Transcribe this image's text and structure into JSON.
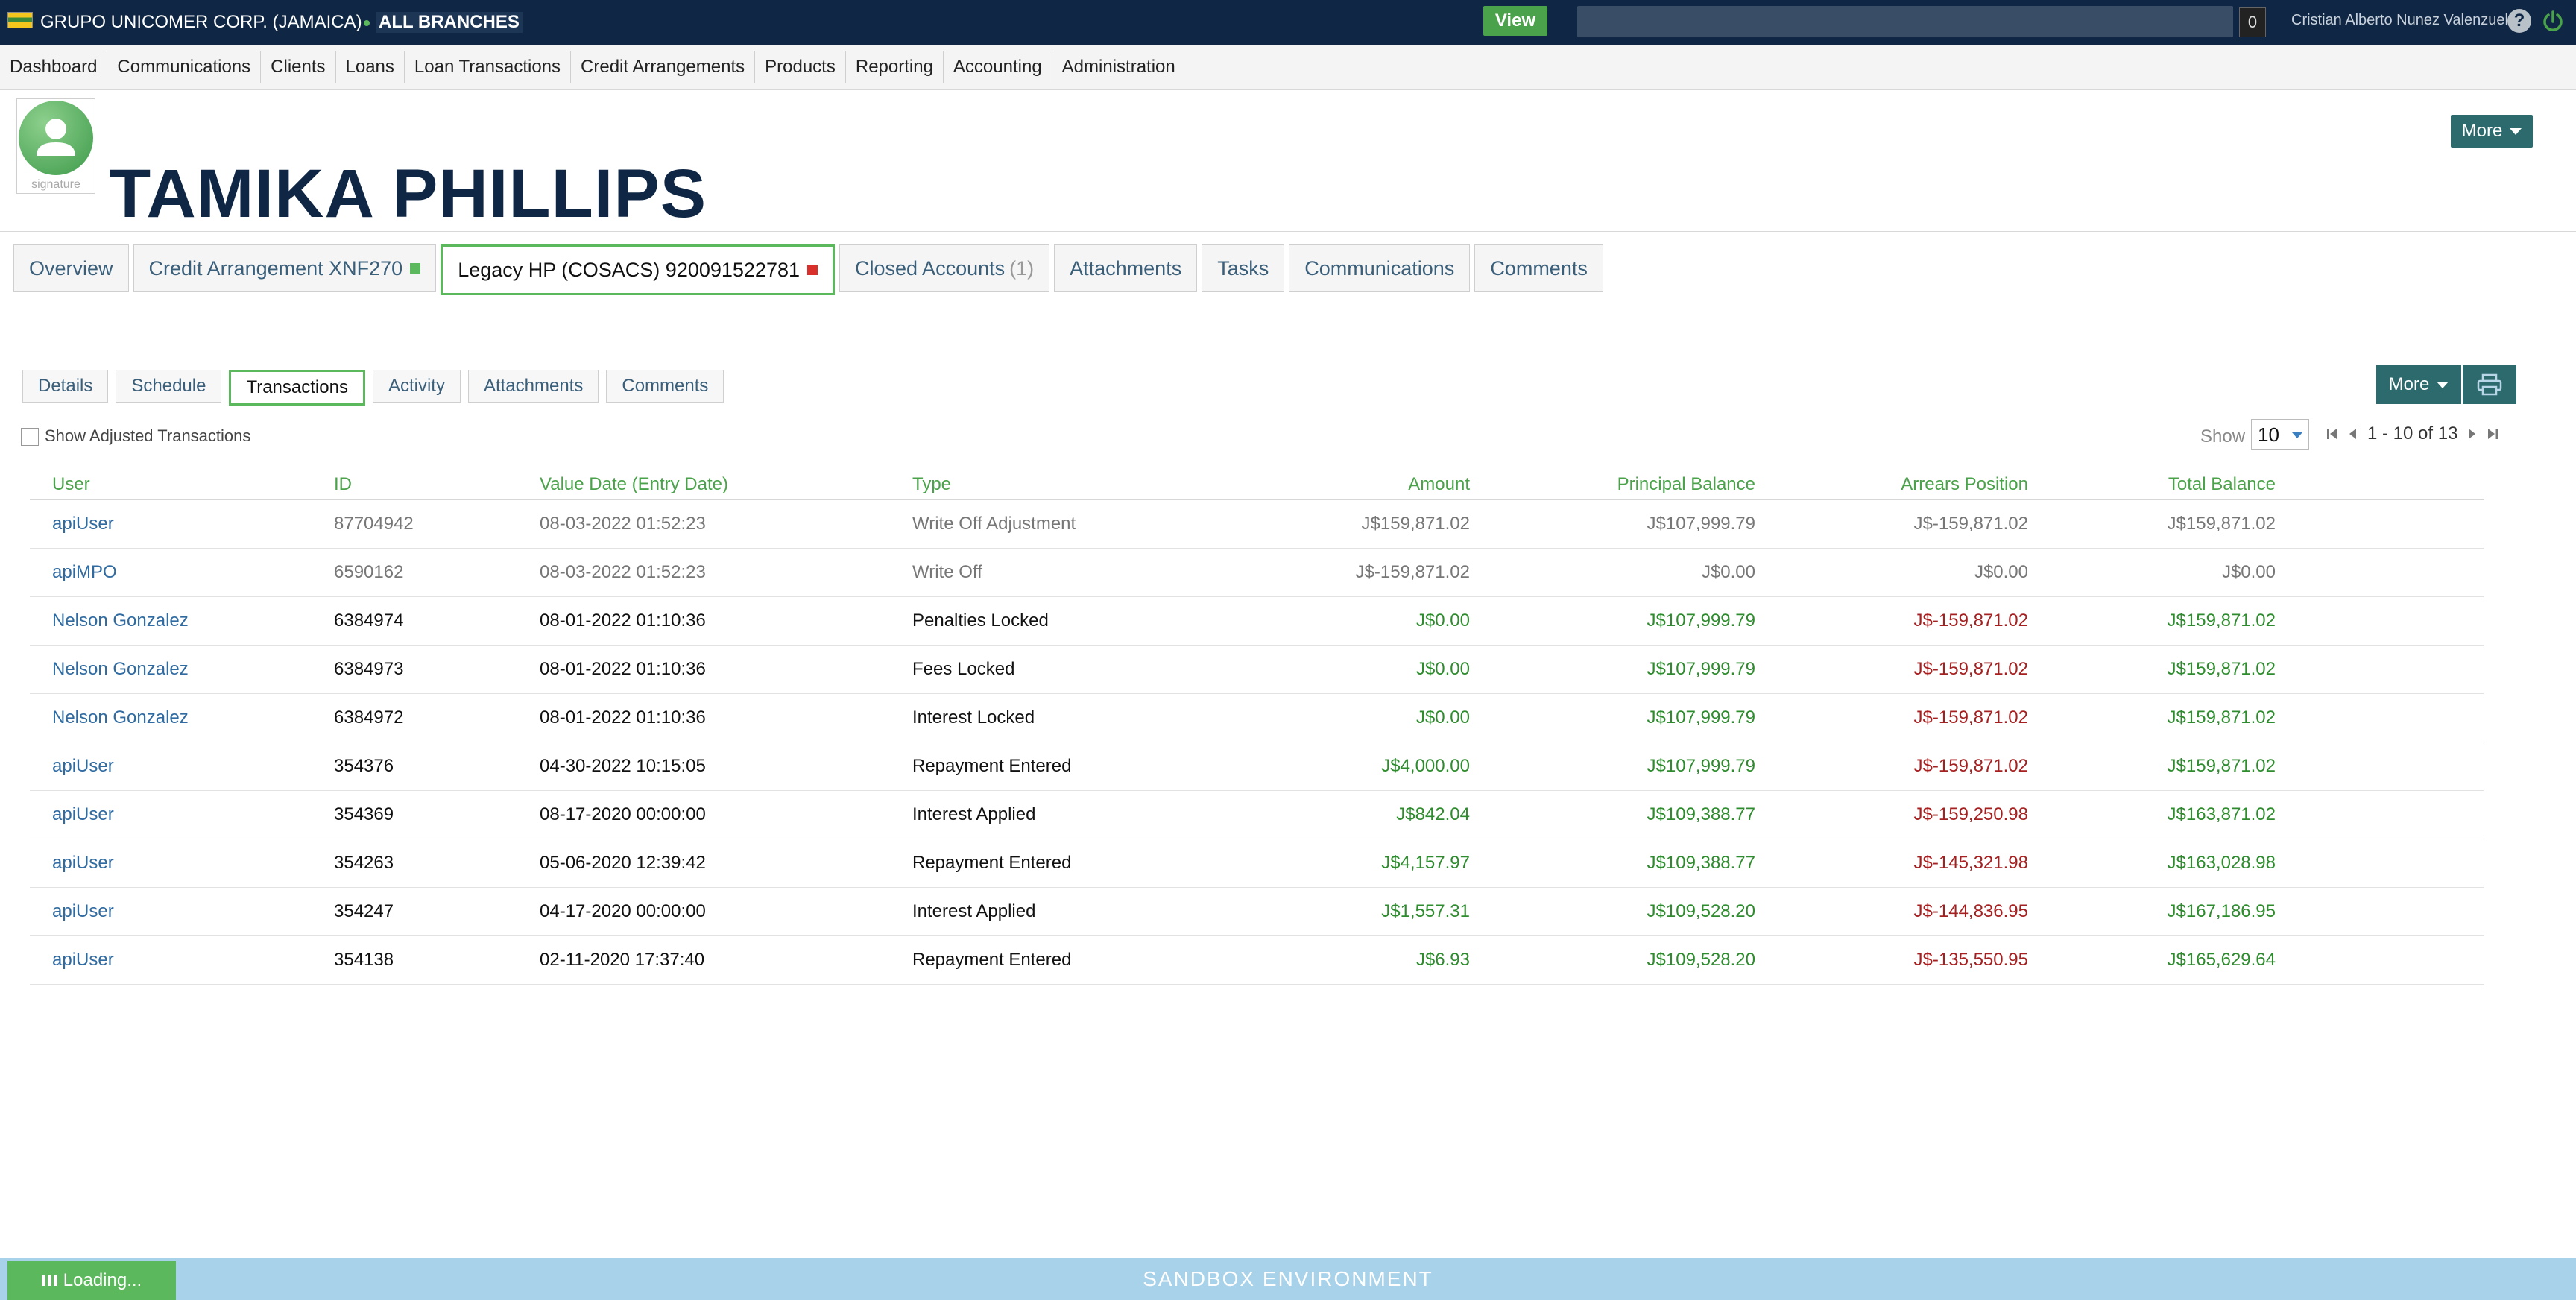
{
  "topbar": {
    "org_name": "GRUPO UNICOMER CORP. (JAMAICA)",
    "branch": "ALL BRANCHES",
    "view_label": "View",
    "search_count": "0",
    "user_name": "Cristian Alberto Nunez Valenzuela",
    "help_symbol": "?"
  },
  "nav": {
    "items": [
      "Dashboard",
      "Communications",
      "Clients",
      "Loans",
      "Loan Transactions",
      "Credit Arrangements",
      "Products",
      "Reporting",
      "Accounting",
      "Administration"
    ]
  },
  "profile": {
    "name": "TAMIKA PHILLIPS",
    "avatar_label": "signature",
    "more_label": "More"
  },
  "account_tabs": {
    "overview": "Overview",
    "credit_arrangement": "Credit Arrangement XNF270",
    "legacy_hp": "Legacy HP (COSACS) 920091522781",
    "closed_accounts": "Closed Accounts",
    "closed_count": "(1)",
    "attachments": "Attachments",
    "tasks": "Tasks",
    "communications": "Communications",
    "comments": "Comments"
  },
  "sub_tabs": {
    "details": "Details",
    "schedule": "Schedule",
    "transactions": "Transactions",
    "activity": "Activity",
    "attachments": "Attachments",
    "comments": "Comments"
  },
  "actions": {
    "more_label": "More"
  },
  "filters": {
    "show_adjusted_label": "Show Adjusted Transactions",
    "show_label": "Show",
    "page_size": "10",
    "page_range": "1 - 10 of 13"
  },
  "table": {
    "headers": {
      "user": "User",
      "id": "ID",
      "date": "Value Date (Entry Date)",
      "type": "Type",
      "amount": "Amount",
      "principal": "Principal Balance",
      "arrears": "Arrears Position",
      "total": "Total Balance"
    },
    "rows": [
      {
        "user": "apiUser",
        "id": "87704942",
        "date": "08-03-2022 01:52:23",
        "type": "Write Off Adjustment",
        "amount": "J$159,871.02",
        "principal": "J$107,999.79",
        "arrears": "J$-159,871.02",
        "total": "J$159,871.02"
      },
      {
        "user": "apiMPO",
        "id": "6590162",
        "date": "08-03-2022 01:52:23",
        "type": "Write Off",
        "amount": "J$-159,871.02",
        "principal": "J$0.00",
        "arrears": "J$0.00",
        "total": "J$0.00"
      },
      {
        "user": "Nelson Gonzalez",
        "id": "6384974",
        "date": "08-01-2022 01:10:36",
        "type": "Penalties Locked",
        "amount": "J$0.00",
        "principal": "J$107,999.79",
        "arrears": "J$-159,871.02",
        "total": "J$159,871.02"
      },
      {
        "user": "Nelson Gonzalez",
        "id": "6384973",
        "date": "08-01-2022 01:10:36",
        "type": "Fees Locked",
        "amount": "J$0.00",
        "principal": "J$107,999.79",
        "arrears": "J$-159,871.02",
        "total": "J$159,871.02"
      },
      {
        "user": "Nelson Gonzalez",
        "id": "6384972",
        "date": "08-01-2022 01:10:36",
        "type": "Interest Locked",
        "amount": "J$0.00",
        "principal": "J$107,999.79",
        "arrears": "J$-159,871.02",
        "total": "J$159,871.02"
      },
      {
        "user": "apiUser",
        "id": "354376",
        "date": "04-30-2022 10:15:05",
        "type": "Repayment Entered",
        "amount": "J$4,000.00",
        "principal": "J$107,999.79",
        "arrears": "J$-159,871.02",
        "total": "J$159,871.02"
      },
      {
        "user": "apiUser",
        "id": "354369",
        "date": "08-17-2020 00:00:00",
        "type": "Interest Applied",
        "amount": "J$842.04",
        "principal": "J$109,388.77",
        "arrears": "J$-159,250.98",
        "total": "J$163,871.02"
      },
      {
        "user": "apiUser",
        "id": "354263",
        "date": "05-06-2020 12:39:42",
        "type": "Repayment Entered",
        "amount": "J$4,157.97",
        "principal": "J$109,388.77",
        "arrears": "J$-145,321.98",
        "total": "J$163,028.98"
      },
      {
        "user": "apiUser",
        "id": "354247",
        "date": "04-17-2020 00:00:00",
        "type": "Interest Applied",
        "amount": "J$1,557.31",
        "principal": "J$109,528.20",
        "arrears": "J$-144,836.95",
        "total": "J$167,186.95"
      },
      {
        "user": "apiUser",
        "id": "354138",
        "date": "02-11-2020 17:37:40",
        "type": "Repayment Entered",
        "amount": "J$6.93",
        "principal": "J$109,528.20",
        "arrears": "J$-135,550.95",
        "total": "J$165,629.64"
      }
    ]
  },
  "footer": {
    "environment": "SANDBOX ENVIRONMENT",
    "loading": "Loading..."
  },
  "colors": {
    "topbar": "#0f2744",
    "accent_green": "#5cb85c",
    "button_teal": "#2d6a6e",
    "amount_green": "#2e8b2e",
    "arrears_red": "#a52020",
    "footer_blue": "#a8d2ea"
  }
}
